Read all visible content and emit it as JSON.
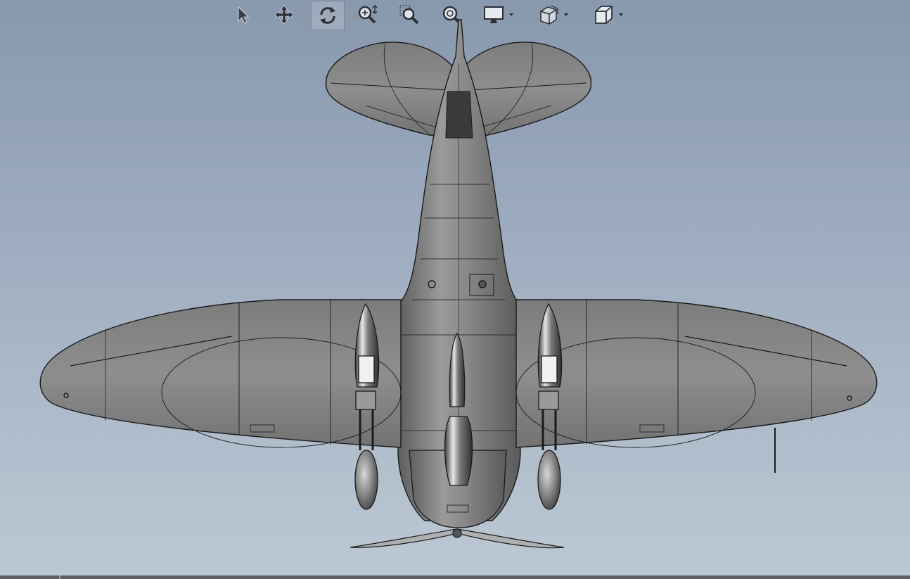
{
  "app": {
    "type": "3D CAD model viewport"
  },
  "toolbar": {
    "items": [
      {
        "id": "select",
        "icon": "cursor-icon",
        "active": false
      },
      {
        "id": "pan",
        "icon": "pan-icon",
        "active": false
      },
      {
        "id": "rotate",
        "icon": "rotate-icon",
        "active": true
      },
      {
        "id": "zoom-in-out",
        "icon": "zoom-in-out-icon",
        "active": false
      },
      {
        "id": "zoom-to-area",
        "icon": "zoom-area-icon",
        "active": false
      },
      {
        "id": "zoom-to-fit",
        "icon": "zoom-fit-icon",
        "active": false
      },
      {
        "id": "display-style",
        "icon": "monitor-icon",
        "active": false,
        "dropdown": true
      },
      {
        "id": "section-view",
        "icon": "section-view-icon",
        "active": false,
        "dropdown": true
      },
      {
        "id": "view-orientation",
        "icon": "cube-icon",
        "active": false,
        "dropdown": true
      }
    ]
  },
  "colors": {
    "background_top": "#8898ad",
    "background_bottom": "#bcc8d4",
    "model_shade": "#8a8a8a",
    "edge_lines": "#1a1a1a",
    "status_bar": "#5d5f63"
  }
}
